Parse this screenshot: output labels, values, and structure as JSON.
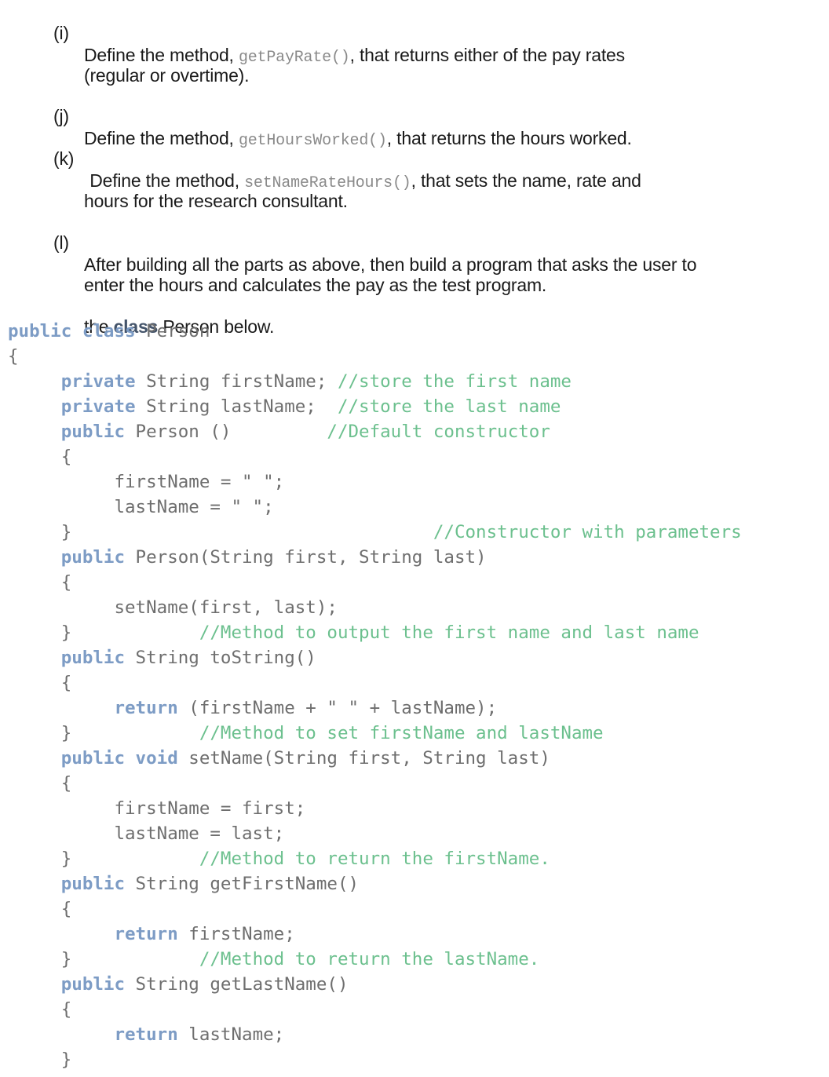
{
  "instructions": [
    {
      "label": "(i)",
      "lines": [
        {
          "before": "Define the method, ",
          "code": "getPayRate()",
          "after": ", that returns either of the pay rates"
        },
        {
          "before": "(regular or overtime).",
          "code": "",
          "after": ""
        }
      ]
    },
    {
      "label": "(j)",
      "lines": [
        {
          "before": "Define the method, ",
          "code": "getHoursWorked()",
          "after": ", that returns the hours worked."
        }
      ]
    },
    {
      "label": "(k)",
      "lines": [
        {
          "before": " Define the method, ",
          "code": "setNameRateHours()",
          "after": ", that sets the name, rate and"
        },
        {
          "before": "hours for the research consultant.",
          "code": "",
          "after": ""
        }
      ]
    },
    {
      "label": "(l)",
      "lines": [
        {
          "before": "After building all the parts as above, then build a program that asks the user to",
          "code": "",
          "after": ""
        },
        {
          "before": "enter the hours and calculates the pay as the test program.",
          "code": "",
          "after": ""
        }
      ]
    }
  ],
  "intro_line": {
    "before": "the ",
    "keyword": "class",
    "after": " Person below."
  },
  "code_lines": [
    [
      {
        "t": "kw",
        "v": "public class"
      },
      {
        "t": "tx",
        "v": " Person"
      }
    ],
    [
      {
        "t": "tx",
        "v": "{"
      }
    ],
    [
      {
        "t": "tx",
        "v": "     "
      },
      {
        "t": "kw",
        "v": "private"
      },
      {
        "t": "tx",
        "v": " String firstName; "
      },
      {
        "t": "cm",
        "v": "//store the first name"
      }
    ],
    [
      {
        "t": "tx",
        "v": "     "
      },
      {
        "t": "kw",
        "v": "private"
      },
      {
        "t": "tx",
        "v": " String lastName;  "
      },
      {
        "t": "cm",
        "v": "//store the last name"
      }
    ],
    [
      {
        "t": "tx",
        "v": "     "
      },
      {
        "t": "kw",
        "v": "public"
      },
      {
        "t": "tx",
        "v": " Person ()         "
      },
      {
        "t": "cm",
        "v": "//Default constructor"
      }
    ],
    [
      {
        "t": "tx",
        "v": "     {"
      }
    ],
    [
      {
        "t": "tx",
        "v": "          firstName = \" \";"
      }
    ],
    [
      {
        "t": "tx",
        "v": "          lastName = \" \";"
      }
    ],
    [
      {
        "t": "tx",
        "v": "     }                                  "
      },
      {
        "t": "cm",
        "v": "//Constructor with parameters"
      }
    ],
    [
      {
        "t": "tx",
        "v": "     "
      },
      {
        "t": "kw",
        "v": "public"
      },
      {
        "t": "tx",
        "v": " Person(String first, String last)"
      }
    ],
    [
      {
        "t": "tx",
        "v": "     {"
      }
    ],
    [
      {
        "t": "tx",
        "v": "          setName(first, last);"
      }
    ],
    [
      {
        "t": "tx",
        "v": "     }            "
      },
      {
        "t": "cm",
        "v": "//Method to output the first name and last name"
      }
    ],
    [
      {
        "t": "tx",
        "v": "     "
      },
      {
        "t": "kw",
        "v": "public"
      },
      {
        "t": "tx",
        "v": " String toString()"
      }
    ],
    [
      {
        "t": "tx",
        "v": "     {"
      }
    ],
    [
      {
        "t": "tx",
        "v": "          "
      },
      {
        "t": "kw",
        "v": "return"
      },
      {
        "t": "tx",
        "v": " (firstName + \" \" + lastName);"
      }
    ],
    [
      {
        "t": "tx",
        "v": "     }            "
      },
      {
        "t": "cm",
        "v": "//Method to set firstName and lastName"
      }
    ],
    [
      {
        "t": "tx",
        "v": "     "
      },
      {
        "t": "kw",
        "v": "public void"
      },
      {
        "t": "tx",
        "v": " setName(String first, String last)"
      }
    ],
    [
      {
        "t": "tx",
        "v": "     {"
      }
    ],
    [
      {
        "t": "tx",
        "v": "          firstName = first;"
      }
    ],
    [
      {
        "t": "tx",
        "v": "          lastName = last;"
      }
    ],
    [
      {
        "t": "tx",
        "v": "     }            "
      },
      {
        "t": "cm",
        "v": "//Method to return the firstName."
      }
    ],
    [
      {
        "t": "tx",
        "v": "     "
      },
      {
        "t": "kw",
        "v": "public"
      },
      {
        "t": "tx",
        "v": " String getFirstName()"
      }
    ],
    [
      {
        "t": "tx",
        "v": "     {"
      }
    ],
    [
      {
        "t": "tx",
        "v": "          "
      },
      {
        "t": "kw",
        "v": "return"
      },
      {
        "t": "tx",
        "v": " firstName;"
      }
    ],
    [
      {
        "t": "tx",
        "v": "     }            "
      },
      {
        "t": "cm",
        "v": "//Method to return the lastName."
      }
    ],
    [
      {
        "t": "tx",
        "v": "     "
      },
      {
        "t": "kw",
        "v": "public"
      },
      {
        "t": "tx",
        "v": " String getLastName()"
      }
    ],
    [
      {
        "t": "tx",
        "v": "     {"
      }
    ],
    [
      {
        "t": "tx",
        "v": "          "
      },
      {
        "t": "kw",
        "v": "return"
      },
      {
        "t": "tx",
        "v": " lastName;"
      }
    ],
    [
      {
        "t": "tx",
        "v": "     }"
      }
    ]
  ]
}
